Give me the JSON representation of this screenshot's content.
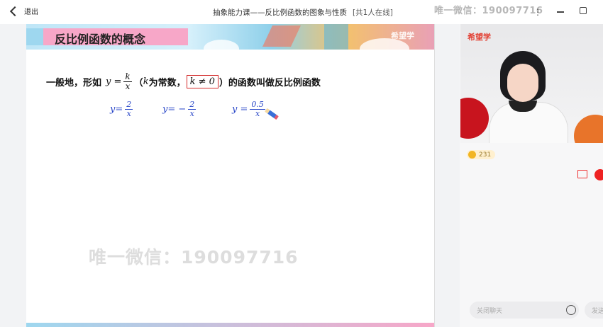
{
  "titlebar": {
    "back_label": "退出",
    "title": "抽象能力课——反比例函数的图象与性质",
    "online": "[共1人在线]",
    "watermark": "唯一微信：190097716",
    "more": "⋮"
  },
  "slide": {
    "heading": "反比例函数的概念",
    "brand": "希望学",
    "line1": {
      "prefix": "一般地，形如",
      "y_eq": "y =",
      "frac_num": "k",
      "frac_den": "x",
      "paren_open": "（",
      "k_var": "k",
      "const_text": "为常数，",
      "condition": "k ≠ 0",
      "suffix": "）的函数叫做反比例函数"
    },
    "examples": [
      {
        "lhs": "y=",
        "num": "2",
        "den": "x"
      },
      {
        "lhs": "y= −",
        "num": "2",
        "den": "x"
      },
      {
        "lhs": "y =",
        "num": "0.5",
        "den": "x"
      }
    ],
    "watermark": "唯一微信：190097716"
  },
  "panel": {
    "video_brand": "希望学",
    "like_count": "231",
    "chat_placeholder": "关闭聊天",
    "send_label": "发送"
  }
}
